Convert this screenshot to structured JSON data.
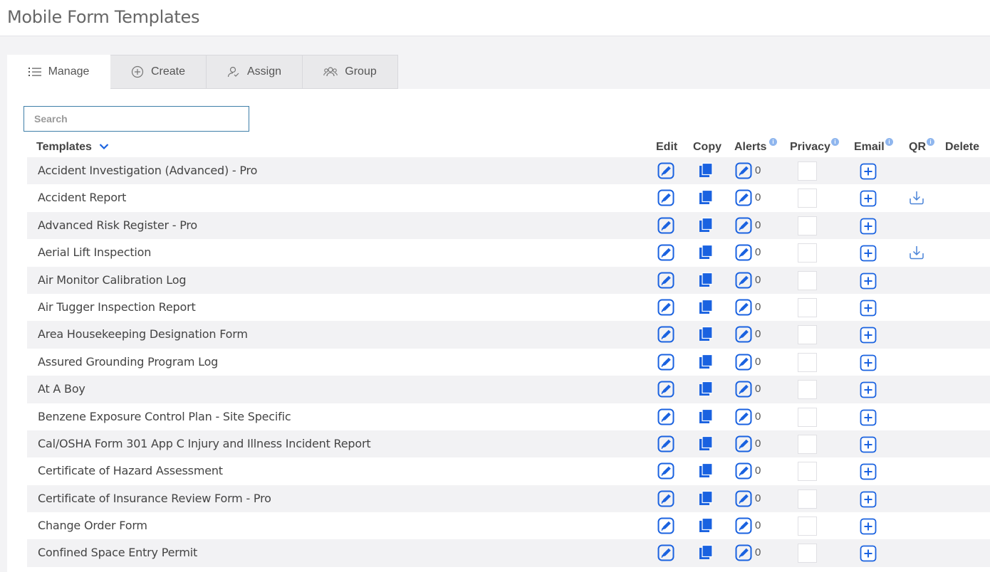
{
  "page": {
    "title": "Mobile Form Templates"
  },
  "tabs": {
    "manage": {
      "label": "Manage",
      "icon": "list-icon"
    },
    "create": {
      "label": "Create",
      "icon": "plus-circle-icon"
    },
    "assign": {
      "label": "Assign",
      "icon": "assign-user-icon"
    },
    "group": {
      "label": "Group",
      "icon": "users-group-icon"
    }
  },
  "search": {
    "placeholder": "Search",
    "value": ""
  },
  "columns": {
    "templates": "Templates",
    "edit": "Edit",
    "copy": "Copy",
    "alerts": "Alerts",
    "privacy": "Privacy",
    "email": "Email",
    "qr": "QR",
    "delete": "Delete",
    "info_marker": "i"
  },
  "colors": {
    "accent": "#2a6fd6",
    "icon_blue": "#1a62e0",
    "row_alt": "#f2f2f4"
  },
  "rows": [
    {
      "name": "Accident Investigation (Advanced) - Pro",
      "alerts": "0",
      "qr": false
    },
    {
      "name": "Accident Report",
      "alerts": "0",
      "qr": true
    },
    {
      "name": "Advanced Risk Register - Pro",
      "alerts": "0",
      "qr": false
    },
    {
      "name": "Aerial Lift Inspection",
      "alerts": "0",
      "qr": true
    },
    {
      "name": "Air Monitor Calibration Log",
      "alerts": "0",
      "qr": false
    },
    {
      "name": "Air Tugger Inspection Report",
      "alerts": "0",
      "qr": false
    },
    {
      "name": "Area Housekeeping Designation Form",
      "alerts": "0",
      "qr": false
    },
    {
      "name": "Assured Grounding Program Log",
      "alerts": "0",
      "qr": false
    },
    {
      "name": "At A Boy",
      "alerts": "0",
      "qr": false
    },
    {
      "name": "Benzene Exposure Control Plan - Site Specific",
      "alerts": "0",
      "qr": false
    },
    {
      "name": "Cal/OSHA Form 301 App C Injury and Illness Incident Report",
      "alerts": "0",
      "qr": false
    },
    {
      "name": "Certificate of Hazard Assessment",
      "alerts": "0",
      "qr": false
    },
    {
      "name": "Certificate of Insurance Review Form - Pro",
      "alerts": "0",
      "qr": false
    },
    {
      "name": "Change Order Form",
      "alerts": "0",
      "qr": false
    },
    {
      "name": "Confined Space Entry Permit",
      "alerts": "0",
      "qr": false
    }
  ]
}
